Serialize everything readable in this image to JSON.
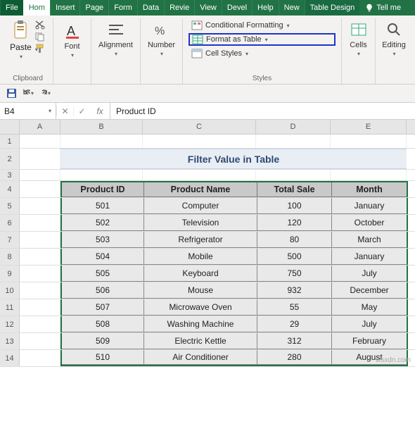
{
  "tabs": {
    "file": "File",
    "home": "Hom",
    "insert": "Insert",
    "page": "Page",
    "form": "Form",
    "data": "Data",
    "review": "Revie",
    "view": "View",
    "devel": "Devel",
    "help": "Help",
    "new": "New",
    "design": "Table Design",
    "tellme": "Tell me"
  },
  "ribbon": {
    "clipboard": {
      "paste": "Paste",
      "label": "Clipboard"
    },
    "font": {
      "label": "Font"
    },
    "alignment": {
      "label": "Alignment"
    },
    "number": {
      "label": "Number"
    },
    "styles": {
      "cond": "Conditional Formatting",
      "format_table": "Format as Table",
      "cell_styles": "Cell Styles",
      "label": "Styles"
    },
    "cells": {
      "label": "Cells"
    },
    "editing": {
      "label": "Editing"
    }
  },
  "namebox": "B4",
  "formula": "Product ID",
  "columns": [
    "A",
    "B",
    "C",
    "D",
    "E"
  ],
  "rows_before": [
    "1",
    "2",
    "3"
  ],
  "title": "Filter Value in Table",
  "table": {
    "headers": [
      "Product ID",
      "Product Name",
      "Total Sale",
      "Month"
    ],
    "rows": [
      {
        "n": "4"
      },
      {
        "n": "5",
        "id": "501",
        "name": "Computer",
        "sale": "100",
        "month": "January"
      },
      {
        "n": "6",
        "id": "502",
        "name": "Television",
        "sale": "120",
        "month": "October"
      },
      {
        "n": "7",
        "id": "503",
        "name": "Refrigerator",
        "sale": "80",
        "month": "March"
      },
      {
        "n": "8",
        "id": "504",
        "name": "Mobile",
        "sale": "500",
        "month": "January"
      },
      {
        "n": "9",
        "id": "505",
        "name": "Keyboard",
        "sale": "750",
        "month": "July"
      },
      {
        "n": "10",
        "id": "506",
        "name": "Mouse",
        "sale": "932",
        "month": "December"
      },
      {
        "n": "11",
        "id": "507",
        "name": "Microwave Oven",
        "sale": "55",
        "month": "May"
      },
      {
        "n": "12",
        "id": "508",
        "name": "Washing Machine",
        "sale": "29",
        "month": "July"
      },
      {
        "n": "13",
        "id": "509",
        "name": "Electric Kettle",
        "sale": "312",
        "month": "February"
      },
      {
        "n": "14",
        "id": "510",
        "name": "Air Conditioner",
        "sale": "280",
        "month": "August"
      }
    ]
  },
  "watermark": "wsxdn.com"
}
